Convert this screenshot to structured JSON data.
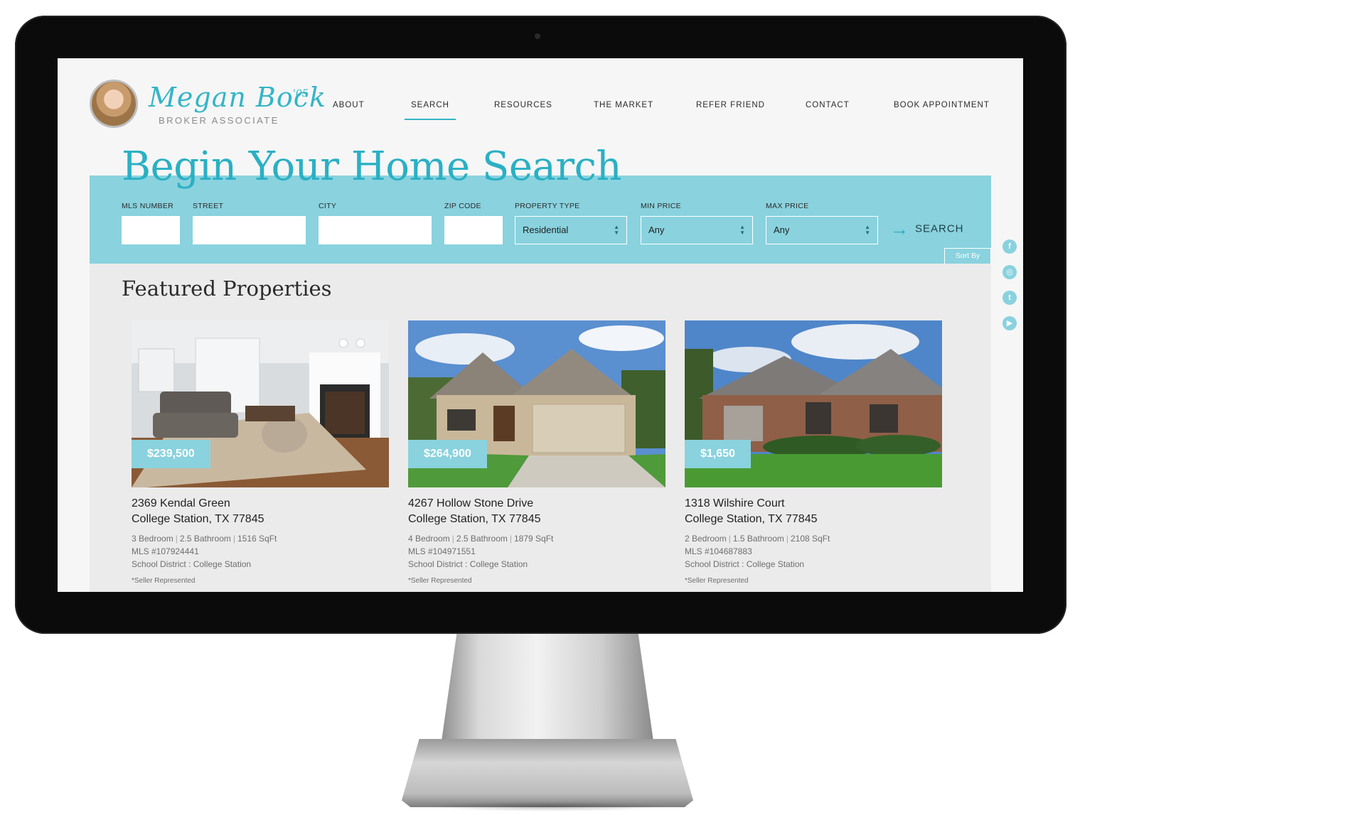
{
  "brand": {
    "name": "Megan Bock",
    "year": "'05",
    "subtitle": "BROKER ASSOCIATE"
  },
  "nav": [
    {
      "label": "ABOUT",
      "active": false
    },
    {
      "label": "SEARCH",
      "active": true
    },
    {
      "label": "RESOURCES",
      "active": false
    },
    {
      "label": "THE MARKET",
      "active": false
    },
    {
      "label": "REFER FRIEND",
      "active": false
    },
    {
      "label": "CONTACT",
      "active": false
    },
    {
      "label": "BOOK APPOINTMENT",
      "active": false
    }
  ],
  "hero": {
    "title": "Begin Your Home Search"
  },
  "search": {
    "labels": {
      "mls": "MLS NUMBER",
      "street": "STREET",
      "city": "CITY",
      "zip": "ZIP CODE",
      "property_type": "PROPERTY TYPE",
      "min_price": "MIN PRICE",
      "max_price": "MAX PRICE"
    },
    "values": {
      "mls": "",
      "street": "",
      "city": "",
      "zip": "",
      "property_type": "Residential",
      "min_price": "Any",
      "max_price": "Any"
    },
    "submit_label": "SEARCH",
    "sort_label": "Sort By"
  },
  "featured": {
    "title": "Featured Properties",
    "properties": [
      {
        "price": "$239,500",
        "address": "2369 Kendal Green",
        "city_line": "College Station, TX  77845",
        "bedrooms": "3 Bedroom",
        "bathrooms": "2.5 Bathroom",
        "sqft": "1516 SqFt",
        "mls": "MLS #107924441",
        "school": "School District : College Station",
        "representation": "*Seller Represented"
      },
      {
        "price": "$264,900",
        "address": "4267 Hollow Stone Drive",
        "city_line": "College Station, TX  77845",
        "bedrooms": "4 Bedroom",
        "bathrooms": "2.5 Bathroom",
        "sqft": "1879 SqFt",
        "mls": "MLS #104971551",
        "school": "School District : College Station",
        "representation": "*Seller Represented"
      },
      {
        "price": "$1,650",
        "address": "1318 Wilshire Court",
        "city_line": "College Station, TX  77845",
        "bedrooms": "2 Bedroom",
        "bathrooms": "1.5 Bathroom",
        "sqft": "2108 SqFt",
        "mls": "MLS #104687883",
        "school": "School District : College Station",
        "representation": "*Seller Represented"
      }
    ]
  },
  "social": [
    {
      "icon": "facebook-icon",
      "glyph": "f"
    },
    {
      "icon": "instagram-icon",
      "glyph": "◎"
    },
    {
      "icon": "twitter-icon",
      "glyph": "t"
    },
    {
      "icon": "youtube-icon",
      "glyph": "▶"
    }
  ],
  "colors": {
    "accent": "#33b5c7",
    "band": "#89d2de",
    "page_bg": "#f6f6f6",
    "content_bg": "#ebebeb"
  }
}
